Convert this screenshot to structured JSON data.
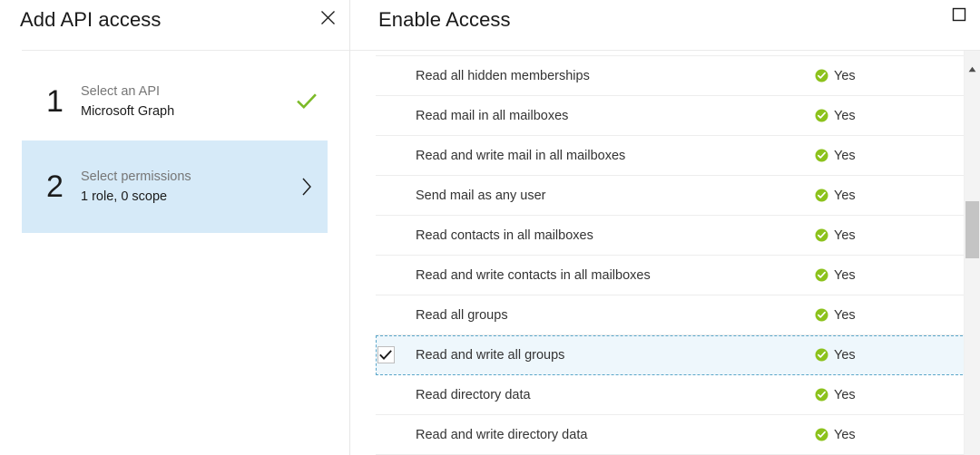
{
  "left_panel": {
    "title": "Add API access",
    "close_icon": "close-icon",
    "steps": [
      {
        "number": "1",
        "label": "Select an API",
        "value": "Microsoft Graph",
        "status_icon": "green-check-icon"
      },
      {
        "number": "2",
        "label": "Select permissions",
        "value": "1 role, 0 scope",
        "status_icon": "chevron-right-icon"
      }
    ]
  },
  "right_panel": {
    "title": "Enable Access",
    "maximize_icon": "maximize-icon",
    "status_icon_name": "green-check-circle-icon",
    "checkbox_icon_name": "checkmark-icon",
    "permissions": [
      {
        "name": "",
        "status": "",
        "checked": false,
        "partial": true
      },
      {
        "name": "Read all hidden memberships",
        "status": "Yes",
        "checked": false
      },
      {
        "name": "Read mail in all mailboxes",
        "status": "Yes",
        "checked": false
      },
      {
        "name": "Read and write mail in all mailboxes",
        "status": "Yes",
        "checked": false
      },
      {
        "name": "Send mail as any user",
        "status": "Yes",
        "checked": false
      },
      {
        "name": "Read contacts in all mailboxes",
        "status": "Yes",
        "checked": false
      },
      {
        "name": "Read and write contacts in all mailboxes",
        "status": "Yes",
        "checked": false
      },
      {
        "name": "Read all groups",
        "status": "Yes",
        "checked": false
      },
      {
        "name": "Read and write all groups",
        "status": "Yes",
        "checked": true
      },
      {
        "name": "Read directory data",
        "status": "Yes",
        "checked": false
      },
      {
        "name": "Read and write directory data",
        "status": "Yes",
        "checked": false
      }
    ]
  },
  "colors": {
    "accent_blue": "#d6eaf8",
    "selected_row": "#eef7fc",
    "focus_dash": "#5aa6c9",
    "green": "#7fba00",
    "text": "#333333",
    "muted_text": "#767676",
    "divider": "#eaeaea"
  },
  "scrollbar": {
    "up_arrow_icon": "scroll-up-arrow-icon"
  }
}
